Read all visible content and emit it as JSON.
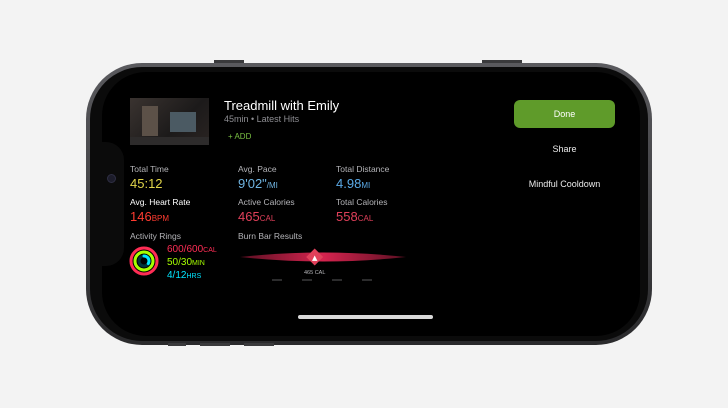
{
  "workout": {
    "title": "Treadmill with Emily",
    "subtitle": "45min • Latest Hits",
    "add_label": "+ ADD"
  },
  "metrics": {
    "total_time": {
      "label": "Total Time",
      "value": "45:12"
    },
    "avg_pace": {
      "label": "Avg. Pace",
      "value": "9'02\"",
      "unit": "/MI"
    },
    "total_distance": {
      "label": "Total Distance",
      "value": "4.98",
      "unit": "MI"
    },
    "avg_heart_rate": {
      "label": "Avg. Heart Rate",
      "value": "146",
      "unit": "BPM"
    },
    "active_calories": {
      "label": "Active Calories",
      "value": "465",
      "unit": "CAL"
    },
    "total_calories": {
      "label": "Total Calories",
      "value": "558",
      "unit": "CAL"
    }
  },
  "activity_rings": {
    "label": "Activity Rings",
    "move": {
      "value": "600/600",
      "unit": "CAL"
    },
    "exercise": {
      "value": "50/30",
      "unit": "MIN"
    },
    "stand": {
      "value": "4/12",
      "unit": "HRS"
    }
  },
  "burn_bar": {
    "label": "Burn Bar Results",
    "marker_value": "465 CAL",
    "position": 0.45
  },
  "actions": {
    "done_label": "Done",
    "share_label": "Share",
    "cooldown_label": "Mindful Cooldown"
  },
  "colors": {
    "time": "#e2d64a",
    "pace": "#6fb3e0",
    "distance": "#5aa9e6",
    "heart": "#ff3b30",
    "calories": "#e0405a",
    "move": "#ff2d55",
    "exercise": "#a6ff00",
    "stand": "#00e5ff",
    "accent": "#7ac143"
  }
}
